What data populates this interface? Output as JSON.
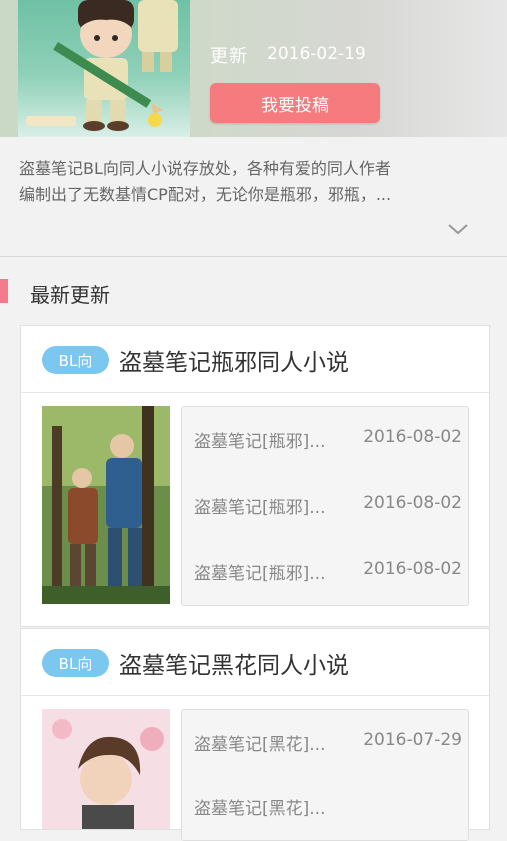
{
  "header": {
    "update_label": "更新",
    "update_date": "2016-02-19",
    "submit_label": "我要投稿"
  },
  "description": {
    "line1": "盗墓笔记BL向同人小说存放处，各种有爱的同人作者",
    "line2": "编制出了无数基情CP配对，无论你是瓶邪，邪瓶，..."
  },
  "section": {
    "title": "最新更新"
  },
  "cards": [
    {
      "tag": "BL向",
      "title": "盗墓笔记瓶邪同人小说",
      "items": [
        {
          "title": "盗墓笔记[瓶邪]...",
          "date": "2016-08-02"
        },
        {
          "title": "盗墓笔记[瓶邪]...",
          "date": "2016-08-02"
        },
        {
          "title": "盗墓笔记[瓶邪]...",
          "date": "2016-08-02"
        }
      ]
    },
    {
      "tag": "BL向",
      "title": "盗墓笔记黑花同人小说",
      "items": [
        {
          "title": "盗墓笔记[黑花]...",
          "date": "2016-07-29"
        },
        {
          "title": "盗墓笔记[黑花]...",
          "date": ""
        }
      ]
    }
  ]
}
